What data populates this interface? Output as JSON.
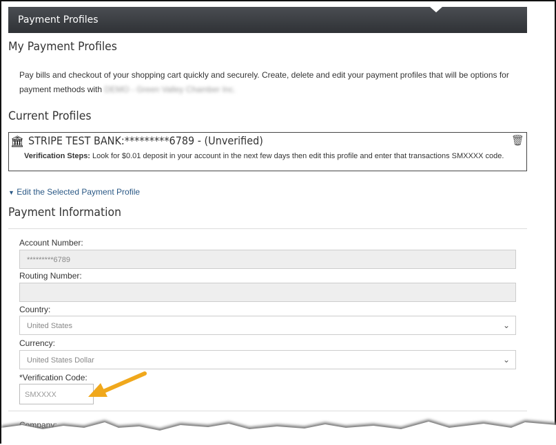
{
  "header": {
    "title": "Payment Profiles"
  },
  "page_title": "My Payment Profiles",
  "intro": {
    "text": "Pay bills and checkout of your shopping cart quickly and securely. Create, delete and edit your payment profiles that will be options for",
    "text2": "payment methods with",
    "org_blurred": "DEMO - Green Valley Chamber Inc."
  },
  "current_profiles": {
    "heading": "Current Profiles",
    "profile": {
      "title": "STRIPE TEST BANK:*********6789 - (Unverified)",
      "steps_label": "Verification Steps:",
      "steps_text": " Look for $0.01 deposit in your account in the next few days then edit this profile and enter that transactions SMXXXX code."
    }
  },
  "edit_link": "Edit the Selected Payment Profile",
  "payment_info": {
    "heading": "Payment Information",
    "account_label": "Account Number:",
    "account_value": "*********6789",
    "routing_label": "Routing Number:",
    "routing_value": "",
    "country_label": "Country:",
    "country_value": "United States",
    "currency_label": "Currency:",
    "currency_value": "United States Dollar",
    "code_label": "*Verification Code:",
    "code_placeholder": "SMXXXX",
    "company_label": "Company:"
  },
  "colors": {
    "arrow": "#f0a81c",
    "link": "#2a5885"
  }
}
